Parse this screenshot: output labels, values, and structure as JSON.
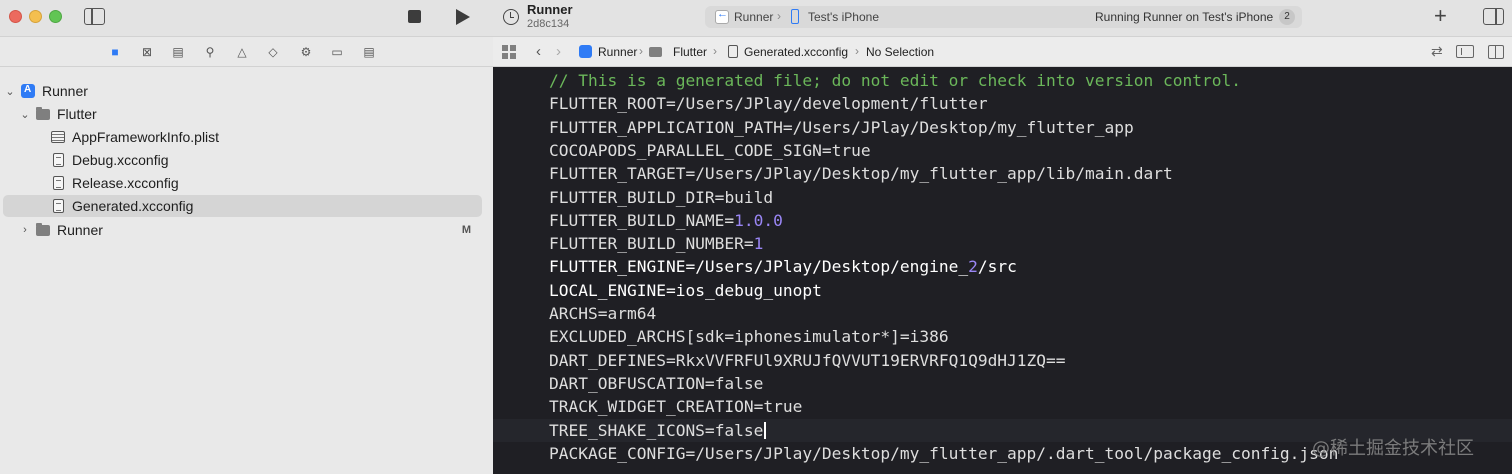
{
  "window": {
    "project_name": "Runner",
    "commit": "2d8c134"
  },
  "status": {
    "scheme": "Runner",
    "device": "Test's iPhone",
    "running_text": "Running Runner on Test's iPhone",
    "running_count": "2"
  },
  "navigator_icons": [
    "folder-icon",
    "source-control-icon",
    "symbol-icon",
    "search-icon",
    "warning-icon",
    "test-icon",
    "debug-icon",
    "breakpoint-icon",
    "report-icon"
  ],
  "tree": [
    {
      "label": "Runner",
      "icon": "app-icon",
      "chevron": "open",
      "level": 0
    },
    {
      "label": "Flutter",
      "icon": "folder-icon",
      "chevron": "open",
      "level": 1
    },
    {
      "label": "AppFrameworkInfo.plist",
      "icon": "plist-icon",
      "chevron": "",
      "level": 2
    },
    {
      "label": "Debug.xcconfig",
      "icon": "file-icon",
      "chevron": "",
      "level": 2
    },
    {
      "label": "Release.xcconfig",
      "icon": "file-icon",
      "chevron": "",
      "level": 2
    },
    {
      "label": "Generated.xcconfig",
      "icon": "file-icon",
      "chevron": "",
      "level": 2,
      "selected": true
    },
    {
      "label": "Runner",
      "icon": "folder-icon",
      "chevron": "closed",
      "level": 1,
      "badge": "M"
    }
  ],
  "jumpbar": {
    "crumbs": [
      "Runner",
      "Flutter",
      "Generated.xcconfig",
      "No Selection"
    ]
  },
  "code": [
    "// This is a generated file; do not edit or check into version control.",
    "FLUTTER_ROOT=/Users/JPlay/development/flutter",
    "FLUTTER_APPLICATION_PATH=/Users/JPlay/Desktop/my_flutter_app",
    "COCOAPODS_PARALLEL_CODE_SIGN=true",
    "FLUTTER_TARGET=/Users/JPlay/Desktop/my_flutter_app/lib/main.dart",
    "FLUTTER_BUILD_DIR=build",
    "FLUTTER_BUILD_NAME=1.0.0",
    "FLUTTER_BUILD_NUMBER=1",
    "FLUTTER_ENGINE=/Users/JPlay/Desktop/engine_2/src",
    "LOCAL_ENGINE=ios_debug_unopt",
    "ARCHS=arm64",
    "EXCLUDED_ARCHS[sdk=iphonesimulator*]=i386",
    "DART_DEFINES=RkxVVFRFUl9XRUJfQVVUT19ERVRFQ1Q9dHJ1ZQ==",
    "DART_OBFUSCATION=false",
    "TRACK_WIDGET_CREATION=true",
    "TREE_SHAKE_ICONS=false",
    "PACKAGE_CONFIG=/Users/JPlay/Desktop/my_flutter_app/.dart_tool/package_config.json"
  ],
  "watermark": "@稀土掘金技术社区",
  "colors": {
    "editor_bg": "#1f1f24",
    "comment": "#6bb75a",
    "number": "#9a86f5",
    "accent": "#2f7bf5"
  }
}
